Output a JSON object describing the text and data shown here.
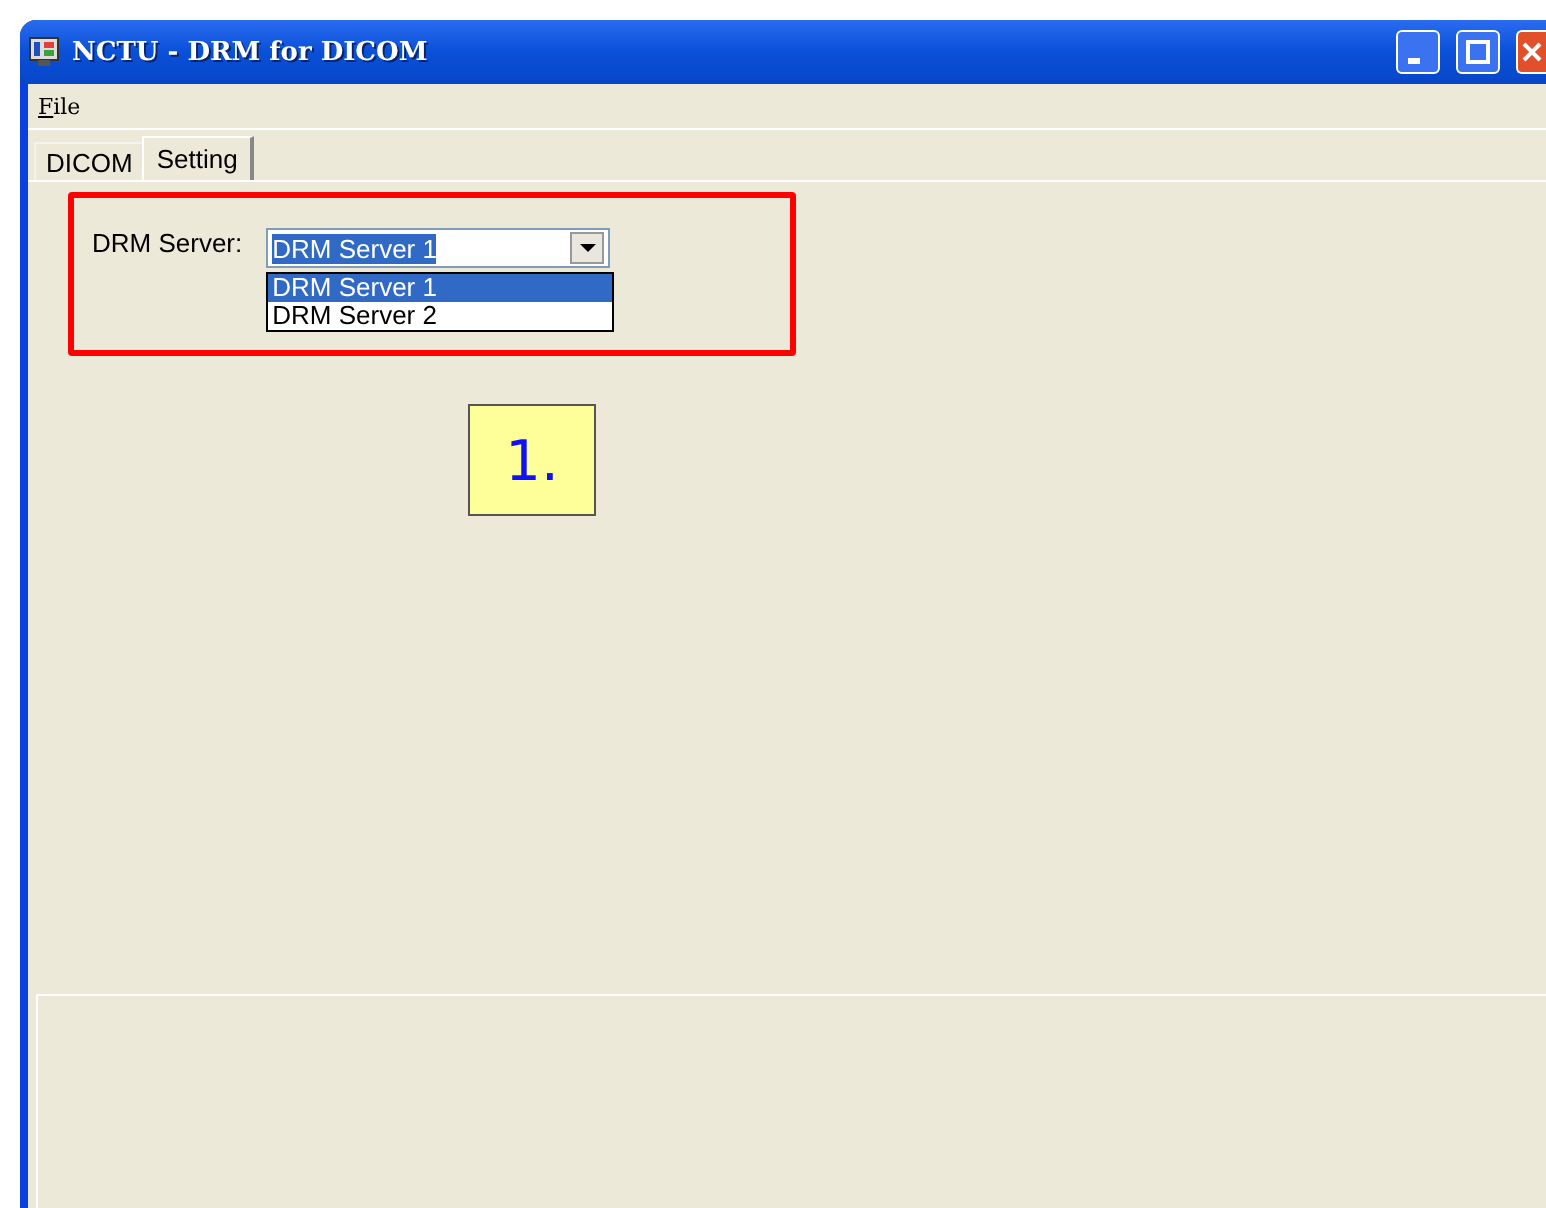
{
  "window": {
    "title": "NCTU - DRM for DICOM"
  },
  "menu": [
    "File"
  ],
  "tabs": [
    {
      "label": "DICOM",
      "selected": false
    },
    {
      "label": "Setting",
      "selected": true
    }
  ],
  "setting": {
    "label": "DRM Server:",
    "value": "DRM Server 1",
    "options": [
      {
        "label": "DRM Server 1",
        "selected": true
      },
      {
        "label": "DRM Server 2",
        "selected": false
      }
    ]
  },
  "callout": "1."
}
